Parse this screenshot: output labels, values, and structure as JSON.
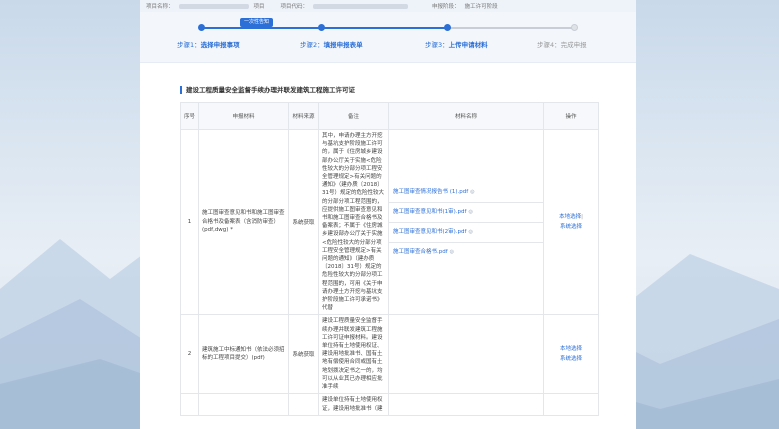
{
  "topbar": {
    "project_name_label": "项目名称：",
    "project_suffix": "项目",
    "project_code_label": "项目代码：",
    "apply_stage_label": "申报阶段：",
    "apply_stage_value": "施工许可阶段"
  },
  "stepper": {
    "current_tag": "一次性告知",
    "steps": [
      {
        "prefix": "步骤1：",
        "label": "选择申报事项"
      },
      {
        "prefix": "步骤2：",
        "label": "填报申报表单"
      },
      {
        "prefix": "步骤3：",
        "label": "上传申请材料"
      },
      {
        "prefix": "步骤4：",
        "label": "完成申报"
      }
    ]
  },
  "colors": {
    "accent": "#2c6fd6",
    "pending": "#c9ced6"
  },
  "section": {
    "title": "建设工程质量安全监督手续办理并联发建筑工程施工许可证",
    "headers": [
      "序号",
      "申报材料",
      "材料来源",
      "备注",
      "材料名称",
      "操作"
    ],
    "rows": [
      {
        "no": "1",
        "material": "施工图审查意见和书和施工图审查合格书及备案表（含消防审查）(pdf,dwg) *",
        "source": "系统获取",
        "note": "其中，申请办理主方开挖与基坑支护阶段施工许可的，属于《住房城乡建设部办公厅关于实施<危险性较大的分部分项工程安全管理规定>有关问题的通知》（建办质〔2018〕31号）规定的危险性较大的分部分项工程范围的，应提供施工图审查意见和书和施工图审查合格书及备案表；不属于《住房城乡建设部办公厅关于实施<危险性较大的分部分项工程安全管理规定>有关问题的通知》（建办质〔2018〕31号）规定的危险性较大的分部分项工程范围的，可用《关于申请办理土方开挖与基坑支护阶段施工许可承诺书》代替",
        "files": [
          "施工图审查情况报告书 (1).pdf",
          "施工图审查意见和书(1审).pdf",
          "施工图审查意见和书(2审).pdf",
          "施工图审查合格书.pdf"
        ],
        "file_icon": "preview-icon",
        "ops": [
          "本地选择",
          "系统选择"
        ]
      },
      {
        "no": "2",
        "material": "建筑施工中标通知书（依法必须招标的工程项目提交）(pdf)",
        "source": "系统获取",
        "note": "建设工程质量安全监督手续办理并联发建筑工程施工许可证申报材料。建设单位持有土地使用权证、建设用地批准书、国有土地有偿使用合同或国有土地划拨决定书之一的，均可以从业其已办理相应批准手续",
        "files": [],
        "file_icon": "",
        "ops": [
          "本地选择",
          "系统选择"
        ]
      },
      {
        "no": "",
        "material": "",
        "source": "",
        "note": "建设单位持有土地使用权证，建设用地批准书（建",
        "files": [],
        "file_icon": "",
        "ops": []
      }
    ]
  }
}
